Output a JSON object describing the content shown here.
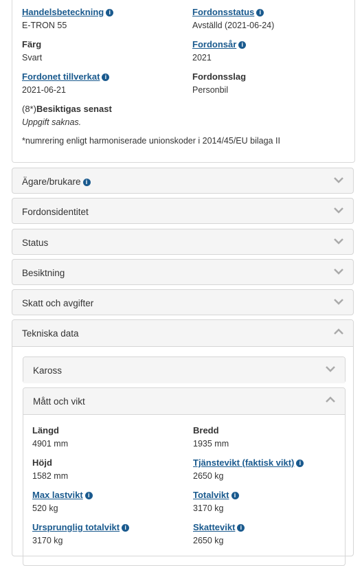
{
  "vehicle": {
    "handelsbeteckning": {
      "label": "Handelsbeteckning",
      "value": "E-TRON 55"
    },
    "fordonsstatus": {
      "label": "Fordonsstatus",
      "value": "Avställd (2021-06-24)"
    },
    "farg": {
      "label": "Färg",
      "value": "Svart"
    },
    "fordonsar": {
      "label": "Fordonsår",
      "value": "2021"
    },
    "tillverkat": {
      "label": "Fordonet tillverkat",
      "value": "2021-06-21"
    },
    "fordonsslag": {
      "label": "Fordonsslag",
      "value": "Personbil"
    },
    "besiktigas": {
      "prefix": "(8*)",
      "label": "Besiktigas senast",
      "value": "Uppgift saknas."
    },
    "footnote": "*numrering enligt harmoniserade unionskoder i 2014/45/EU bilaga II"
  },
  "sections": {
    "agare": "Ägare/brukare",
    "identitet": "Fordonsidentitet",
    "status": "Status",
    "besiktning": "Besiktning",
    "skatt": "Skatt och avgifter",
    "teknisk": "Tekniska data"
  },
  "teknisk": {
    "kaross": "Kaross",
    "matt": "Mått och vikt",
    "fields": {
      "langd": {
        "label": "Längd",
        "value": "4901 mm"
      },
      "bredd": {
        "label": "Bredd",
        "value": "1935 mm"
      },
      "hojd": {
        "label": "Höjd",
        "value": "1582 mm"
      },
      "tjanstevikt": {
        "label": "Tjänstevikt (faktisk vikt)",
        "value": "2650 kg"
      },
      "maxlast": {
        "label": "Max lastvikt",
        "value": "520 kg"
      },
      "totalvikt": {
        "label": "Totalvikt",
        "value": "3170 kg"
      },
      "ursprunglig": {
        "label": "Ursprunglig totalvikt",
        "value": "3170 kg"
      },
      "skattevikt": {
        "label": "Skattevikt",
        "value": "2650 kg"
      }
    }
  },
  "icons": {
    "info": "info-icon",
    "down": "chevron-down-icon",
    "up": "chevron-up-icon"
  }
}
